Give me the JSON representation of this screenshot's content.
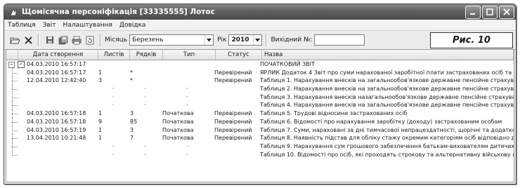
{
  "window": {
    "title": "Щомісячна персоніфікація [33335555] Лотос"
  },
  "menu": [
    "Таблиця",
    "Звіт",
    "Налаштування",
    "Довідка"
  ],
  "toolbar": {
    "month_label": "Місяць",
    "month_value": "Березень",
    "year_label": "Рік",
    "year_value": "2010",
    "outgoing_label": "Вихідний №:",
    "outgoing_value": ""
  },
  "figure_label": "Рис. 10",
  "columns": [
    "Дата створення",
    "Листів",
    "Рядків",
    "Тип",
    "Статус",
    "Назва"
  ],
  "rows": [
    {
      "date": "04.03.2010 16:57:17",
      "sheets": "",
      "lines": "",
      "type": "",
      "status": "",
      "name": "ПОЧАТКОВИЙ ЗВІТ"
    },
    {
      "date": "04.03.2010 16:57:17",
      "sheets": "1",
      "lines": "*",
      "type": "",
      "status": "Перевірений",
      "name": "ЯРЛИК Додаток 4 Звіт про суми нарахованої заробітної плати застрахованих осіб та суми"
    },
    {
      "date": "12.04.2010 12:42:40",
      "sheets": "3",
      "lines": "*",
      "type": "",
      "status": "Перевірений",
      "name": "Таблиця 1. Нарахування внесків на загальнообов'язкове державне пенсійне страхування"
    },
    {
      "date": "",
      "sheets": "·",
      "lines": "·",
      "type": "·",
      "status": "",
      "name": "Таблиця 2. Нарахування внесків на загальнообов'язкове державне пенсійне страхування"
    },
    {
      "date": "",
      "sheets": "·",
      "lines": "·",
      "type": "·",
      "status": "",
      "name": "Таблиця 3. Нарахування внесків назагальнообов'язкове державне пенсійне страхування"
    },
    {
      "date": "",
      "sheets": "·",
      "lines": "·",
      "type": "·",
      "status": "",
      "name": "Таблиця 4. Нарахування внесків на загальнообов'язкове державне пенсійне страхування"
    },
    {
      "date": "04.03.2010 16:57:18",
      "sheets": "1",
      "lines": "3",
      "type": "Початкова",
      "status": "Перевірений",
      "name": "Таблиця 5. Трудові відносини застрахованих осіб"
    },
    {
      "date": "04.03.2010 16:57:18",
      "sheets": "9",
      "lines": "85",
      "type": "Початкова",
      "status": "Перевірений",
      "name": "Таблиця 6. Відомості про нарахування заробітку (доходу) застрахованим особам"
    },
    {
      "date": "04.03.2010 16:57:19",
      "sheets": "1",
      "lines": "3",
      "type": "Початкова",
      "status": "Перевірений",
      "name": "Таблиця 7. Суми, нараховані за дні тимчасової непрацездатності, щорічні та додаткові відп"
    },
    {
      "date": "13.04.2010 10:21:48",
      "sheets": "1",
      "lines": "7",
      "type": "Початкова",
      "status": "Перевірений",
      "name": "Таблиця 8. Наявність підстав для обліку стажу окремим категоріям осіб відповідно до зако"
    },
    {
      "date": "",
      "sheets": "·",
      "lines": "·",
      "type": "·",
      "status": "",
      "name": "Таблиця 9. Нарахування сум грошового забезпечення батькам-вихователям дитячих будин"
    },
    {
      "date": "",
      "sheets": "·",
      "lines": "·",
      "type": "·",
      "status": "",
      "name": "Таблиця 10. Відомості про осіб, які проходять строкову та альтернативну військову службу"
    }
  ]
}
